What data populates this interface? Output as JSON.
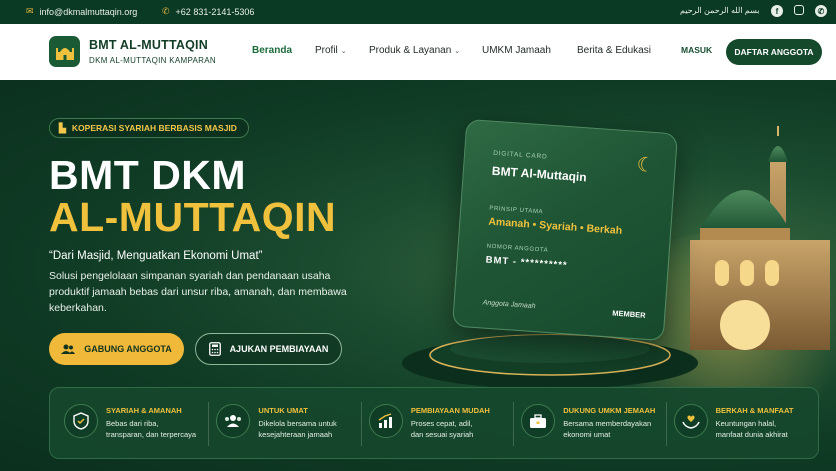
{
  "topbar": {
    "email": "info@dkmalmuttaqin.org",
    "phone": "+62 831-2141-5306",
    "arabic": "بسم الله الرحمن الرحيم",
    "social": [
      "facebook-icon",
      "instagram-icon",
      "whatsapp-icon"
    ]
  },
  "nav": {
    "brand_title": "BMT AL-MUTTAQIN",
    "brand_subtitle": "DKM AL-MUTTAQIN KAMPARAN",
    "menu": [
      {
        "label": "Beranda",
        "active": true
      },
      {
        "label": "Profil",
        "dropdown": true
      },
      {
        "label": "Produk & Layanan",
        "dropdown": true
      },
      {
        "label": "UMKM Jamaah"
      },
      {
        "label": "Berita & Edukasi"
      }
    ],
    "login_label": "MASUK",
    "register_label": "DAFTAR ANGGOTA"
  },
  "hero": {
    "badge": "KOPERASI SYARIAH BERBASIS MASJID",
    "title_line1": "BMT DKM",
    "title_line2": "AL-MUTTAQIN",
    "quote": "“Dari Masjid, Menguatkan Ekonomi Umat”",
    "description": "Solusi pengelolaan simpanan syariah dan pendanaan usaha produktif jamaah bebas dari unsur riba, amanah, dan membawa keberkahan.",
    "cta_primary": "GABUNG ANGGOTA",
    "cta_secondary": "AJUKAN PEMBIAYAAN"
  },
  "card": {
    "label": "DIGITAL CARD",
    "title": "BMT Al-Muttaqin",
    "principle_label": "PRINSIP UTAMA",
    "principle_value": "Amanah • Syariah • Berkah",
    "number_label": "NOMOR ANGGOTA",
    "number_value": "BMT  -  **********",
    "footer_left": "Anggota Jamaah",
    "footer_right": "MEMBER"
  },
  "features": [
    {
      "icon": "shield-icon",
      "title": "SYARIAH & AMANAH",
      "line1": "Bebas dari riba,",
      "line2": "transparan, dan terpercaya"
    },
    {
      "icon": "people-icon",
      "title": "UNTUK UMAT",
      "line1": "Dikelola bersama untuk",
      "line2": "kesejahteraan jamaah"
    },
    {
      "icon": "growth-chart-icon",
      "title": "PEMBIAYAAN MUDAH",
      "line1": "Proses cepat, adil,",
      "line2": "dan sesuai syariah"
    },
    {
      "icon": "briefcase-icon",
      "title": "DUKUNG UMKM JEMAAH",
      "line1": "Bersama memberdayakan",
      "line2": "ekonomi umat"
    },
    {
      "icon": "heart-hands-icon",
      "title": "BERKAH & MANFAAT",
      "line1": "Keuntungan halal,",
      "line2": "manfaat dunia akhirat"
    }
  ],
  "colors": {
    "primary_green": "#14492c",
    "accent_gold": "#f0c13d",
    "topbar": "#0b3a24"
  }
}
